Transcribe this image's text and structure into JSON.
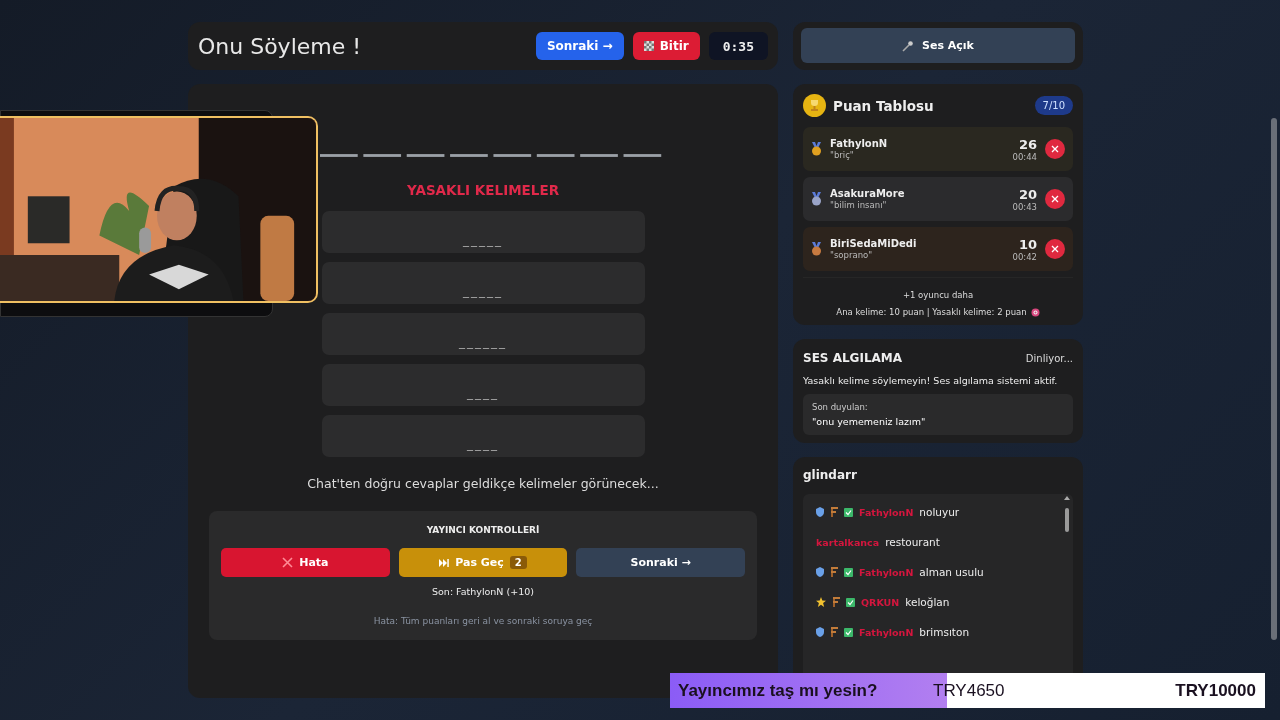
{
  "header": {
    "title": "Onu Söyleme !",
    "next_button": "Sonraki →",
    "finish_button": "Bitir",
    "timer": "0:35"
  },
  "game": {
    "banned_title": "YASAKLI KELIMELER",
    "banned_words": [
      "_____",
      "_____",
      "______",
      "____",
      "____"
    ],
    "hint": "Chat'ten doğru cevaplar geldikçe kelimeler görünecek...",
    "controls": {
      "title": "YAYINCI KONTROLLERİ",
      "error_button": "Hata",
      "skip_button": "Pas Geç",
      "skip_count": "2",
      "next_button": "Sonraki →",
      "last": "Son: FathylonN (+10)",
      "note": "Hata: Tüm puanları geri al ve sonraki soruya geç"
    }
  },
  "sound_button": {
    "label": "Ses Açık",
    "on": true
  },
  "scoreboard": {
    "title": "Puan Tablosu",
    "round": "7/10",
    "players": [
      {
        "kind": "gold",
        "name": "FathylonN",
        "answer": "\"briç\"",
        "score": "26",
        "time": "00:44"
      },
      {
        "kind": "silver",
        "name": "AsakuraMore",
        "answer": "\"bilim insanı\"",
        "score": "20",
        "time": "00:43"
      },
      {
        "kind": "bronze",
        "name": "BiriSedaMiDedi",
        "answer": "\"soprano\"",
        "score": "10",
        "time": "00:42"
      }
    ],
    "more": "+1 oyuncu daha",
    "rules": "Ana kelime: 10 puan | Yasaklı kelime: 2 puan"
  },
  "voice": {
    "title": "SES ALGILAMA",
    "status": "Dinliyor...",
    "warning": "Yasaklı kelime söylemeyin! Ses algılama sistemi aktif.",
    "last_label": "Son duyulan:",
    "last_heard": "\"onu yememeniz lazım\""
  },
  "chat": {
    "title": "glindarr",
    "messages": [
      {
        "kind": "shield",
        "user": "FathylonN",
        "text": "noluyur"
      },
      {
        "kind": "plain",
        "user": "kartalkanca",
        "text": "restourant"
      },
      {
        "kind": "shield",
        "user": "FathylonN",
        "text": "alman usulu"
      },
      {
        "kind": "star",
        "user": "QRKUN",
        "text": "keloğlan"
      },
      {
        "kind": "shield",
        "user": "FathylonN",
        "text": "brimsıton"
      }
    ]
  },
  "donation_goal": {
    "title": "Yayıncımız taş mı yesin?",
    "current": "TRY4650",
    "target": "TRY10000",
    "level": 0.465
  }
}
